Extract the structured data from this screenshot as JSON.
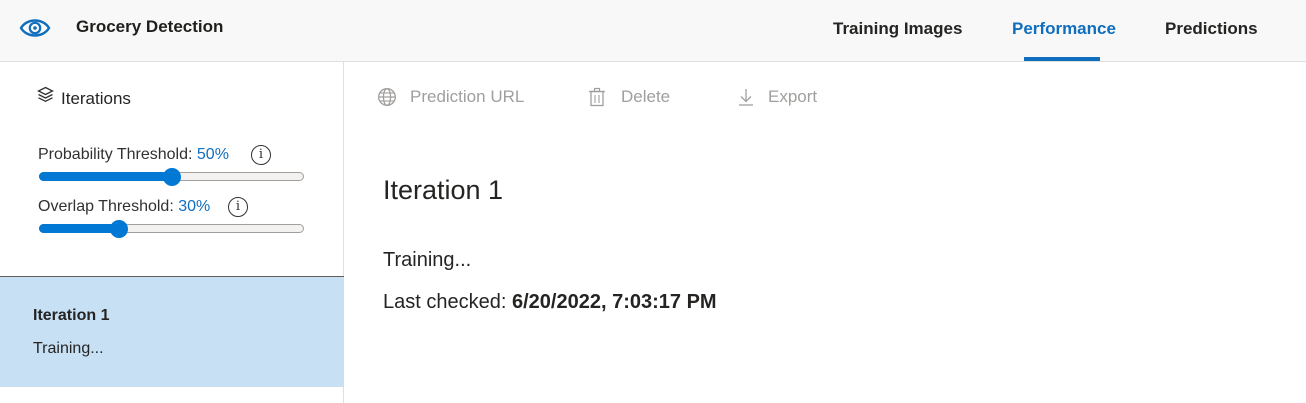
{
  "header": {
    "app_title": "Grocery Detection",
    "tabs": [
      {
        "label": "Training Images",
        "active": false
      },
      {
        "label": "Performance",
        "active": true
      },
      {
        "label": "Predictions",
        "active": false
      }
    ],
    "accent_color": "#106ebe"
  },
  "sidebar": {
    "iterations_label": "Iterations",
    "probability": {
      "label": "Probability Threshold:",
      "value_text": "50%",
      "value": 0.5
    },
    "overlap": {
      "label": "Overlap Threshold:",
      "value_text": "30%",
      "value": 0.3
    },
    "info_glyph": "i",
    "iteration_items": [
      {
        "title": "Iteration 1",
        "status": "Training...",
        "selected": true
      }
    ]
  },
  "toolbar": {
    "prediction_url": "Prediction URL",
    "delete": "Delete",
    "export": "Export",
    "icons": [
      "globe-icon",
      "trash-icon",
      "download-icon"
    ]
  },
  "main": {
    "title": "Iteration 1",
    "status": "Training...",
    "last_checked_label": "Last checked:",
    "last_checked_value": "6/20/2022, 7:03:17 PM"
  }
}
